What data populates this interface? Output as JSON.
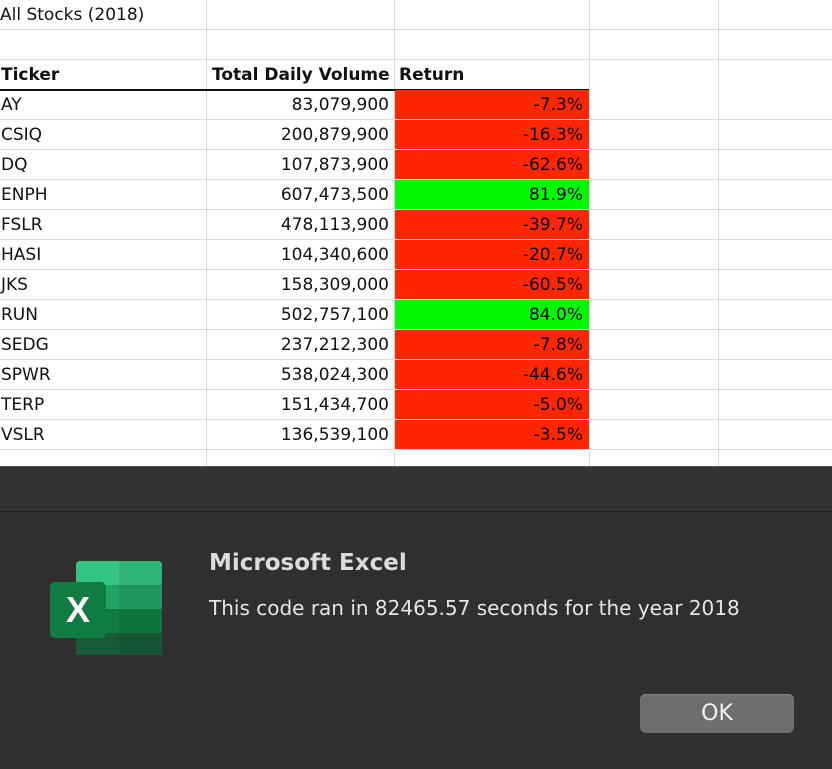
{
  "sheet": {
    "title": "All Stocks (2018)",
    "headers": {
      "ticker": "Ticker",
      "volume": "Total Daily Volume",
      "return": "Return"
    },
    "rows": [
      {
        "ticker": "AY",
        "volume": "83,079,900",
        "return": "-7.3%",
        "status": "negative"
      },
      {
        "ticker": "CSIQ",
        "volume": "200,879,900",
        "return": "-16.3%",
        "status": "negative"
      },
      {
        "ticker": "DQ",
        "volume": "107,873,900",
        "return": "-62.6%",
        "status": "negative"
      },
      {
        "ticker": "ENPH",
        "volume": "607,473,500",
        "return": "81.9%",
        "status": "positive"
      },
      {
        "ticker": "FSLR",
        "volume": "478,113,900",
        "return": "-39.7%",
        "status": "negative"
      },
      {
        "ticker": "HASI",
        "volume": "104,340,600",
        "return": "-20.7%",
        "status": "negative"
      },
      {
        "ticker": "JKS",
        "volume": "158,309,000",
        "return": "-60.5%",
        "status": "negative"
      },
      {
        "ticker": "RUN",
        "volume": "502,757,100",
        "return": "84.0%",
        "status": "positive"
      },
      {
        "ticker": "SEDG",
        "volume": "237,212,300",
        "return": "-7.8%",
        "status": "negative"
      },
      {
        "ticker": "SPWR",
        "volume": "538,024,300",
        "return": "-44.6%",
        "status": "negative"
      },
      {
        "ticker": "TERP",
        "volume": "151,434,700",
        "return": "-5.0%",
        "status": "negative"
      },
      {
        "ticker": "VSLR",
        "volume": "136,539,100",
        "return": "-3.5%",
        "status": "negative"
      }
    ]
  },
  "colors": {
    "negative": "#ff2600",
    "positive": "#00f900",
    "dialog_bg": "#2f2f2f",
    "ok_button": "#6e6e6e"
  },
  "dialog": {
    "icon": "microsoft-excel-icon",
    "logo_letter": "X",
    "title": "Microsoft Excel",
    "message": "This code ran in 82465.57 seconds for the year 2018",
    "ok_label": "OK"
  }
}
